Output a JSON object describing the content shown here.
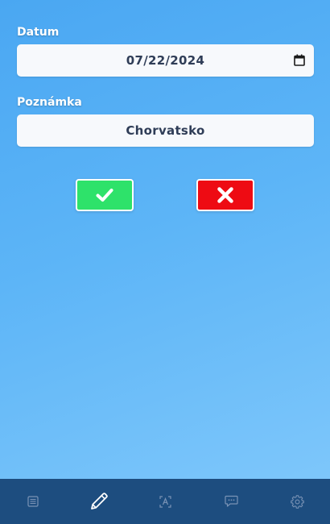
{
  "form": {
    "date_label": "Datum",
    "date_value": "07/22/2024",
    "note_label": "Poznámka",
    "note_value": "Chorvatsko"
  },
  "actions": {
    "confirm_icon": "check-icon",
    "cancel_icon": "x-icon",
    "confirm_color": "#2ee26a",
    "cancel_color": "#ee0b13"
  },
  "nav": {
    "items": [
      {
        "icon": "list-icon",
        "active": false
      },
      {
        "icon": "pencil-icon",
        "active": true
      },
      {
        "icon": "text-scan-icon",
        "active": false
      },
      {
        "icon": "message-icon",
        "active": false
      },
      {
        "icon": "gear-icon",
        "active": false
      }
    ],
    "background": "#1d4d7f"
  }
}
